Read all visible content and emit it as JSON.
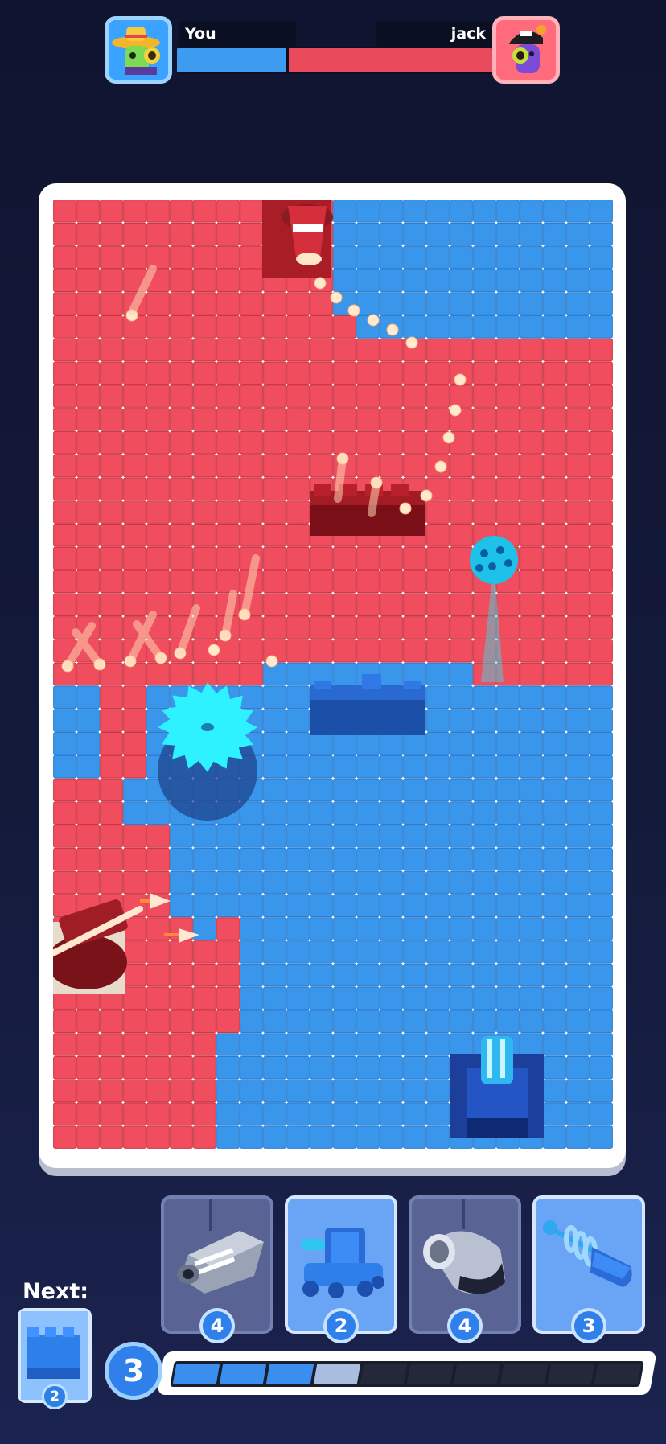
{
  "hud": {
    "player_name": "You",
    "opponent_name": "jack",
    "player_avatar_icon": "cactus-sombrero-avatar",
    "opponent_avatar_icon": "cactus-cap-avatar",
    "player_color": "#3d9cf0",
    "opponent_color": "#e94a5c",
    "player_territory_fraction": 0.35
  },
  "board": {
    "player_color": "#3a96ea",
    "opponent_color": "#f04d5f",
    "units": [
      "red-cannon",
      "red-crossbow",
      "red-wall",
      "blue-wall",
      "blue-spiked-ball",
      "cyan-saw-blade",
      "blue-turret"
    ]
  },
  "next": {
    "label": "Next:",
    "card_icon": "wall-icon",
    "cost": "2"
  },
  "cards": [
    {
      "icon": "laser-cannon-icon",
      "cost": "4",
      "enabled": false
    },
    {
      "icon": "tank-icon",
      "cost": "2",
      "enabled": true
    },
    {
      "icon": "mortar-icon",
      "cost": "4",
      "enabled": false
    },
    {
      "icon": "spring-blaster-icon",
      "cost": "3",
      "enabled": true
    }
  ],
  "elixir": {
    "count": "3",
    "segments_total": 10,
    "segments_full": 3,
    "partial_fraction": 0.5
  }
}
